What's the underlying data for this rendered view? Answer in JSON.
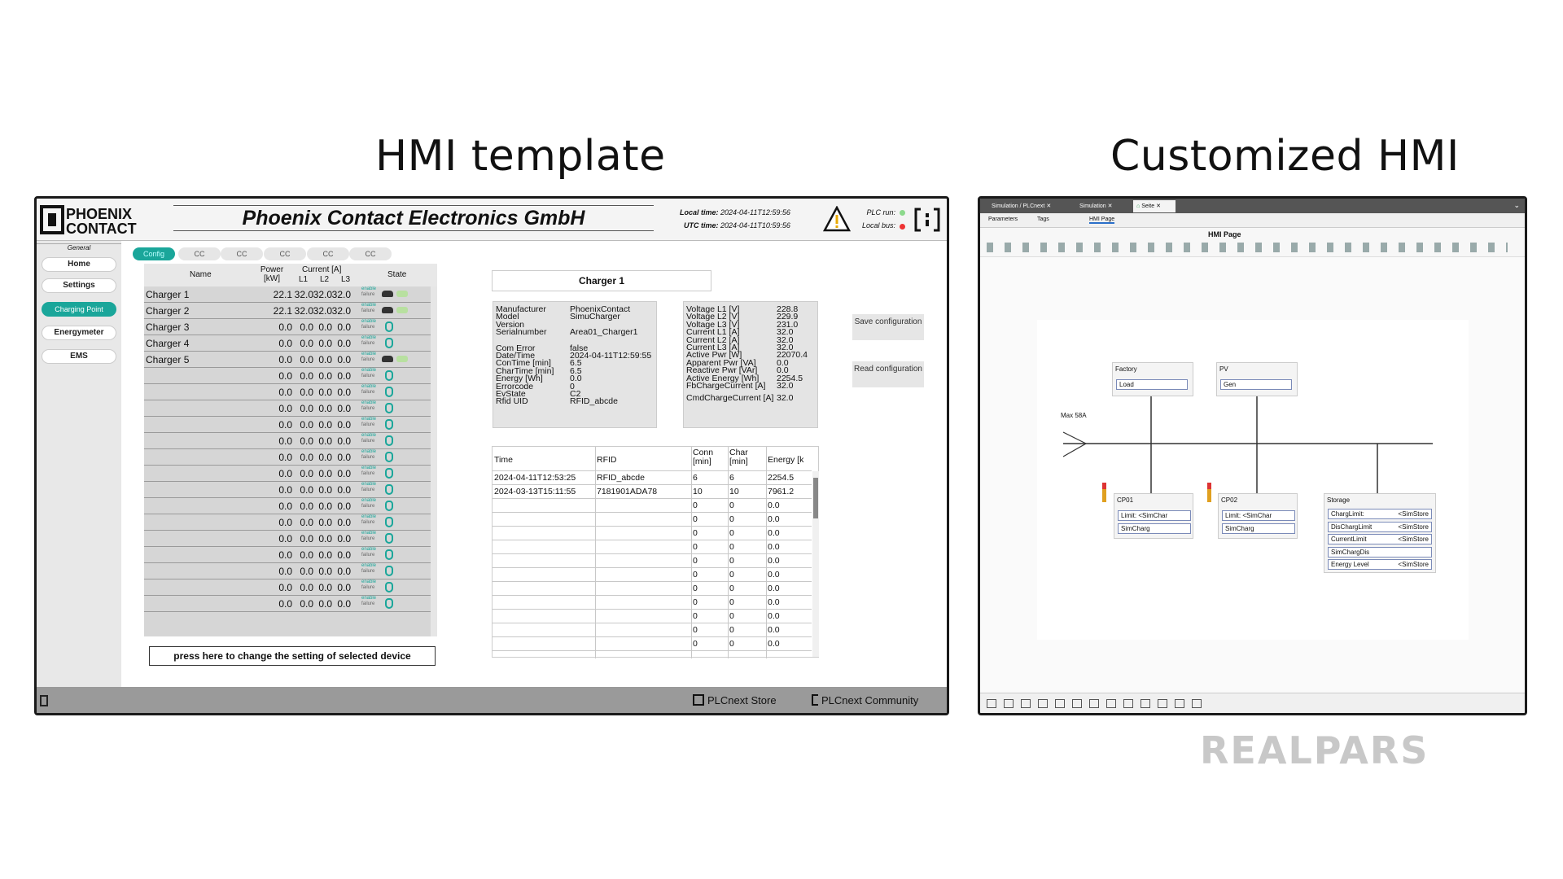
{
  "titles": {
    "left": "HMI template",
    "right": "Customized HMI"
  },
  "watermark": "REALPARS",
  "hmi": {
    "company": "Phoenix Contact Electronics GmbH",
    "logo_text": "PHOENIX CONTACT",
    "local_time_label": "Local time:",
    "local_time": "2024-04-11T12:59:56",
    "utc_time_label": "UTC time:",
    "utc_time": "2024-04-11T10:59:56",
    "plc_run_label": "PLC run:",
    "local_bus_label": "Local bus:",
    "sidebar": {
      "group": "General",
      "items": [
        "Home",
        "Settings",
        "Charging Point",
        "Energymeter",
        "EMS"
      ]
    },
    "tabs": [
      "Config",
      "CC",
      "CC",
      "CC",
      "CC",
      "CC"
    ],
    "table_headers": {
      "name": "Name",
      "power": "Power [kW]",
      "current": "Current [A]",
      "l1": "L1",
      "l2": "L2",
      "l3": "L3",
      "state": "State"
    },
    "chargers": [
      {
        "name": "Charger 1",
        "p": "22.1",
        "l1": "32.0",
        "l2": "32.0",
        "l3": "32.0",
        "icon": "car"
      },
      {
        "name": "Charger 2",
        "p": "22.1",
        "l1": "32.0",
        "l2": "32.0",
        "l3": "32.0",
        "icon": "car"
      },
      {
        "name": "Charger 3",
        "p": "0.0",
        "l1": "0.0",
        "l2": "0.0",
        "l3": "0.0",
        "icon": "plug"
      },
      {
        "name": "Charger 4",
        "p": "0.0",
        "l1": "0.0",
        "l2": "0.0",
        "l3": "0.0",
        "icon": "plug"
      },
      {
        "name": "Charger 5",
        "p": "0.0",
        "l1": "0.0",
        "l2": "0.0",
        "l3": "0.0",
        "icon": "car"
      },
      {
        "name": "",
        "p": "0.0",
        "l1": "0.0",
        "l2": "0.0",
        "l3": "0.0",
        "icon": "plug"
      },
      {
        "name": "",
        "p": "0.0",
        "l1": "0.0",
        "l2": "0.0",
        "l3": "0.0",
        "icon": "plug"
      },
      {
        "name": "",
        "p": "0.0",
        "l1": "0.0",
        "l2": "0.0",
        "l3": "0.0",
        "icon": "plug"
      },
      {
        "name": "",
        "p": "0.0",
        "l1": "0.0",
        "l2": "0.0",
        "l3": "0.0",
        "icon": "plug"
      },
      {
        "name": "",
        "p": "0.0",
        "l1": "0.0",
        "l2": "0.0",
        "l3": "0.0",
        "icon": "plug"
      },
      {
        "name": "",
        "p": "0.0",
        "l1": "0.0",
        "l2": "0.0",
        "l3": "0.0",
        "icon": "plug"
      },
      {
        "name": "",
        "p": "0.0",
        "l1": "0.0",
        "l2": "0.0",
        "l3": "0.0",
        "icon": "plug"
      },
      {
        "name": "",
        "p": "0.0",
        "l1": "0.0",
        "l2": "0.0",
        "l3": "0.0",
        "icon": "plug"
      },
      {
        "name": "",
        "p": "0.0",
        "l1": "0.0",
        "l2": "0.0",
        "l3": "0.0",
        "icon": "plug"
      },
      {
        "name": "",
        "p": "0.0",
        "l1": "0.0",
        "l2": "0.0",
        "l3": "0.0",
        "icon": "plug"
      },
      {
        "name": "",
        "p": "0.0",
        "l1": "0.0",
        "l2": "0.0",
        "l3": "0.0",
        "icon": "plug"
      },
      {
        "name": "",
        "p": "0.0",
        "l1": "0.0",
        "l2": "0.0",
        "l3": "0.0",
        "icon": "plug"
      },
      {
        "name": "",
        "p": "0.0",
        "l1": "0.0",
        "l2": "0.0",
        "l3": "0.0",
        "icon": "plug"
      },
      {
        "name": "",
        "p": "0.0",
        "l1": "0.0",
        "l2": "0.0",
        "l3": "0.0",
        "icon": "plug"
      },
      {
        "name": "",
        "p": "0.0",
        "l1": "0.0",
        "l2": "0.0",
        "l3": "0.0",
        "icon": "plug"
      }
    ],
    "enable": "enable",
    "failure": "failure",
    "press_button": "press here to change the setting of selected device",
    "charger_title": "Charger 1",
    "info_left": [
      [
        "Manufacturer",
        "PhoenixContact"
      ],
      [
        "Model",
        "SimuCharger"
      ],
      [
        "Version",
        ""
      ],
      [
        "Serialnumber",
        "Area01_Charger1"
      ],
      [
        "Com Error",
        "false"
      ],
      [
        "Date/Time",
        "2024-04-11T12:59:55"
      ],
      [
        "ConTime [min]",
        "6.5"
      ],
      [
        "CharTime [min]",
        "6.5"
      ],
      [
        "Energy [Wh]",
        "0.0"
      ],
      [
        "Errorcode",
        "0"
      ],
      [
        "EvState",
        "C2"
      ],
      [
        "Rfid UID",
        "RFID_abcde"
      ]
    ],
    "info_right": [
      [
        "Voltage L1 [V]",
        "228.8"
      ],
      [
        "Voltage L2 [V]",
        "229.9"
      ],
      [
        "Voltage L3 [V]",
        "231.0"
      ],
      [
        "Current L1 [A]",
        "32.0"
      ],
      [
        "Current L2 [A]",
        "32.0"
      ],
      [
        "Current L3 [A]",
        "32.0"
      ],
      [
        "Active Pwr [W]",
        "22070.4"
      ],
      [
        "Apparent Pwr [VA]",
        "0.0"
      ],
      [
        "Reactive Pwr [VAr]",
        "0.0"
      ],
      [
        "Active Energy [Wh]",
        "2254.5"
      ],
      [
        "FbChargeCurrent [A]",
        "32.0"
      ],
      [
        "CmdChargeCurrent [A]",
        "32.0"
      ]
    ],
    "save_btn": "Save configuration",
    "read_btn": "Read configuration",
    "history_headers": [
      "Time",
      "RFID",
      "Conn [min]",
      "Char [min]",
      "Energy [k"
    ],
    "history": [
      [
        "2024-04-11T12:53:25",
        "RFID_abcde",
        "6",
        "6",
        "2254.5"
      ],
      [
        "2024-03-13T15:11:55",
        "7181901ADA78",
        "10",
        "10",
        "7961.2"
      ],
      [
        "",
        "",
        "0",
        "0",
        "0.0"
      ],
      [
        "",
        "",
        "0",
        "0",
        "0.0"
      ],
      [
        "",
        "",
        "0",
        "0",
        "0.0"
      ],
      [
        "",
        "",
        "0",
        "0",
        "0.0"
      ],
      [
        "",
        "",
        "0",
        "0",
        "0.0"
      ],
      [
        "",
        "",
        "0",
        "0",
        "0.0"
      ],
      [
        "",
        "",
        "0",
        "0",
        "0.0"
      ],
      [
        "",
        "",
        "0",
        "0",
        "0.0"
      ],
      [
        "",
        "",
        "0",
        "0",
        "0.0"
      ],
      [
        "",
        "",
        "0",
        "0",
        "0.0"
      ],
      [
        "",
        "",
        "0",
        "0",
        "0.0"
      ]
    ],
    "footer_store": "PLCnext Store",
    "footer_community": "PLCnext Community"
  },
  "editor": {
    "tabs": [
      "Simulation / PLCnext",
      "Simulation",
      "Seite"
    ],
    "subtabs": [
      "Parameters",
      "Tags",
      "HMI Page"
    ],
    "page_title": "HMI Page",
    "max_label": "Max 58A",
    "factory": {
      "title": "Factory",
      "field": "Load"
    },
    "pv": {
      "title": "PV",
      "field": "Gen"
    },
    "cp01": {
      "title": "CP01",
      "f1": "Limit: <SimChar",
      "f2": "SimCharg"
    },
    "cp02": {
      "title": "CP02",
      "f1": "Limit: <SimChar",
      "f2": "SimCharg"
    },
    "storage": {
      "title": "Storage",
      "rows": [
        [
          "ChargLimit:",
          "<SimStore"
        ],
        [
          "DisChargLimit",
          "<SimStore"
        ],
        [
          "CurrentLimit",
          "<SimStore"
        ],
        [
          "SimChargDis",
          ""
        ],
        [
          "Energy Level",
          "<SimStore"
        ]
      ]
    }
  }
}
